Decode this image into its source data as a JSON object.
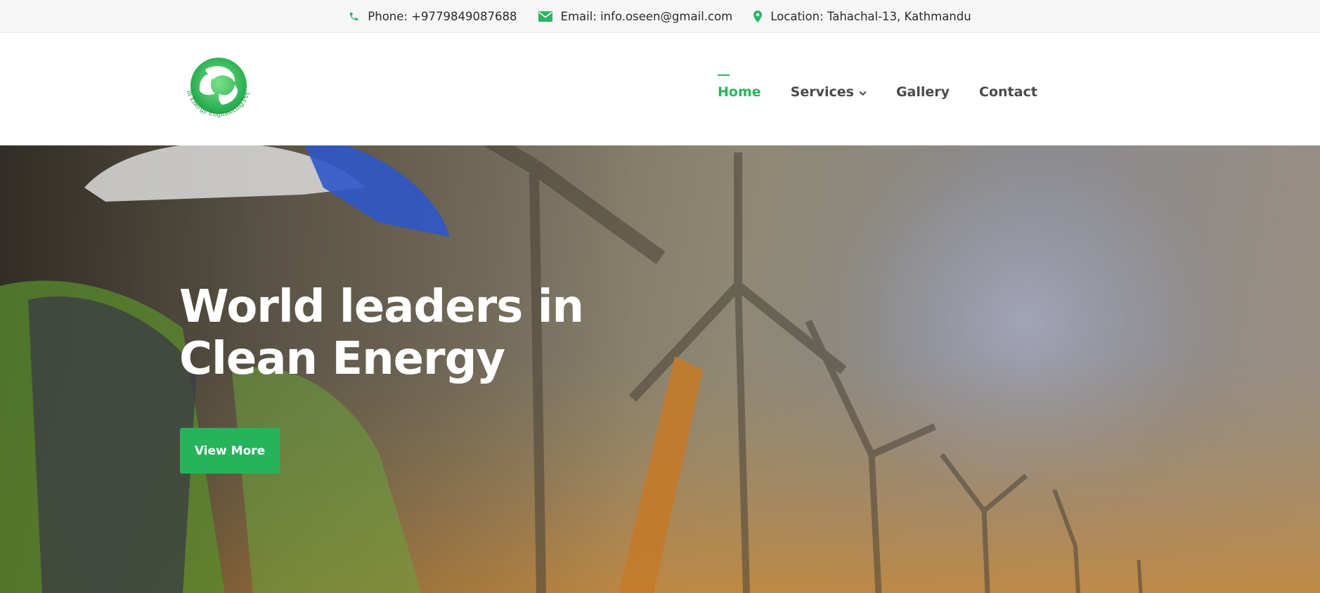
{
  "topbar": {
    "phone": "Phone: +9779849087688",
    "email": "Email: info.oseen@gmail.com",
    "location": "Location: Tahachal-13, Kathmandu",
    "icon_color": "#2bb463"
  },
  "header": {
    "logo_text": "Oshin Energy Engineering Pvt. Ltd",
    "nav": {
      "home": "Home",
      "services": "Services",
      "gallery": "Gallery",
      "contact": "Contact"
    },
    "active_item": "Home",
    "accent": "#2bb463"
  },
  "hero": {
    "title_line1": "World leaders in",
    "title_line2": "Clean Energy",
    "button_label": "View More",
    "button_color": "#25b35c"
  }
}
